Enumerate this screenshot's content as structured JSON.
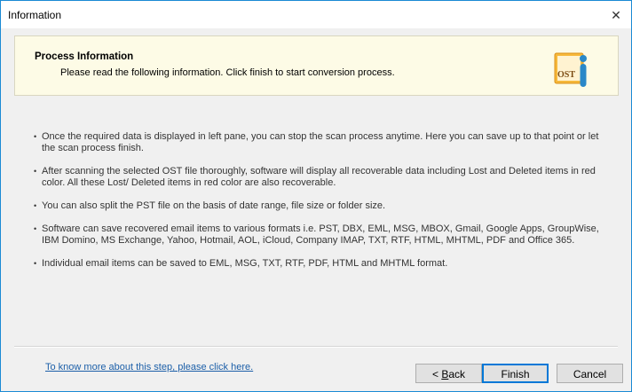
{
  "window": {
    "title": "Information",
    "close_glyph": "✕"
  },
  "banner": {
    "title": "Process Information",
    "subtitle": "Please read the following information. Click finish to start conversion process.",
    "logo_text": "OST",
    "logo_icon": "ost-info-icon"
  },
  "bullets": [
    "Once the required data is displayed in left pane, you can stop the scan process anytime. Here you can save up to that point or let the scan process finish.",
    "After scanning the selected OST file thoroughly, software will display all recoverable data including Lost and Deleted items in red color. All these Lost/ Deleted items in red color are also recoverable.",
    "You can also split the PST file on the basis of date range, file size or folder size.",
    "Software can save recovered email items to various formats i.e. PST, DBX, EML, MSG, MBOX, Gmail, Google Apps, GroupWise, IBM Domino, MS Exchange, Yahoo, Hotmail, AOL, iCloud, Company IMAP, TXT, RTF, HTML, MHTML, PDF and Office 365.",
    "Individual email items can be saved to EML, MSG, TXT, RTF, PDF, HTML and MHTML format."
  ],
  "footer": {
    "help_link": "To know more about this step, please click here.",
    "back_prefix": "< ",
    "back_mnemonic": "B",
    "back_rest": "ack",
    "finish": "Finish",
    "cancel": "Cancel"
  },
  "colors": {
    "accent": "#1a8ad4",
    "banner_bg": "#fdfbe6",
    "link": "#1c5fa8",
    "logo_orange": "#f0a020",
    "logo_blue": "#2a88c8"
  }
}
